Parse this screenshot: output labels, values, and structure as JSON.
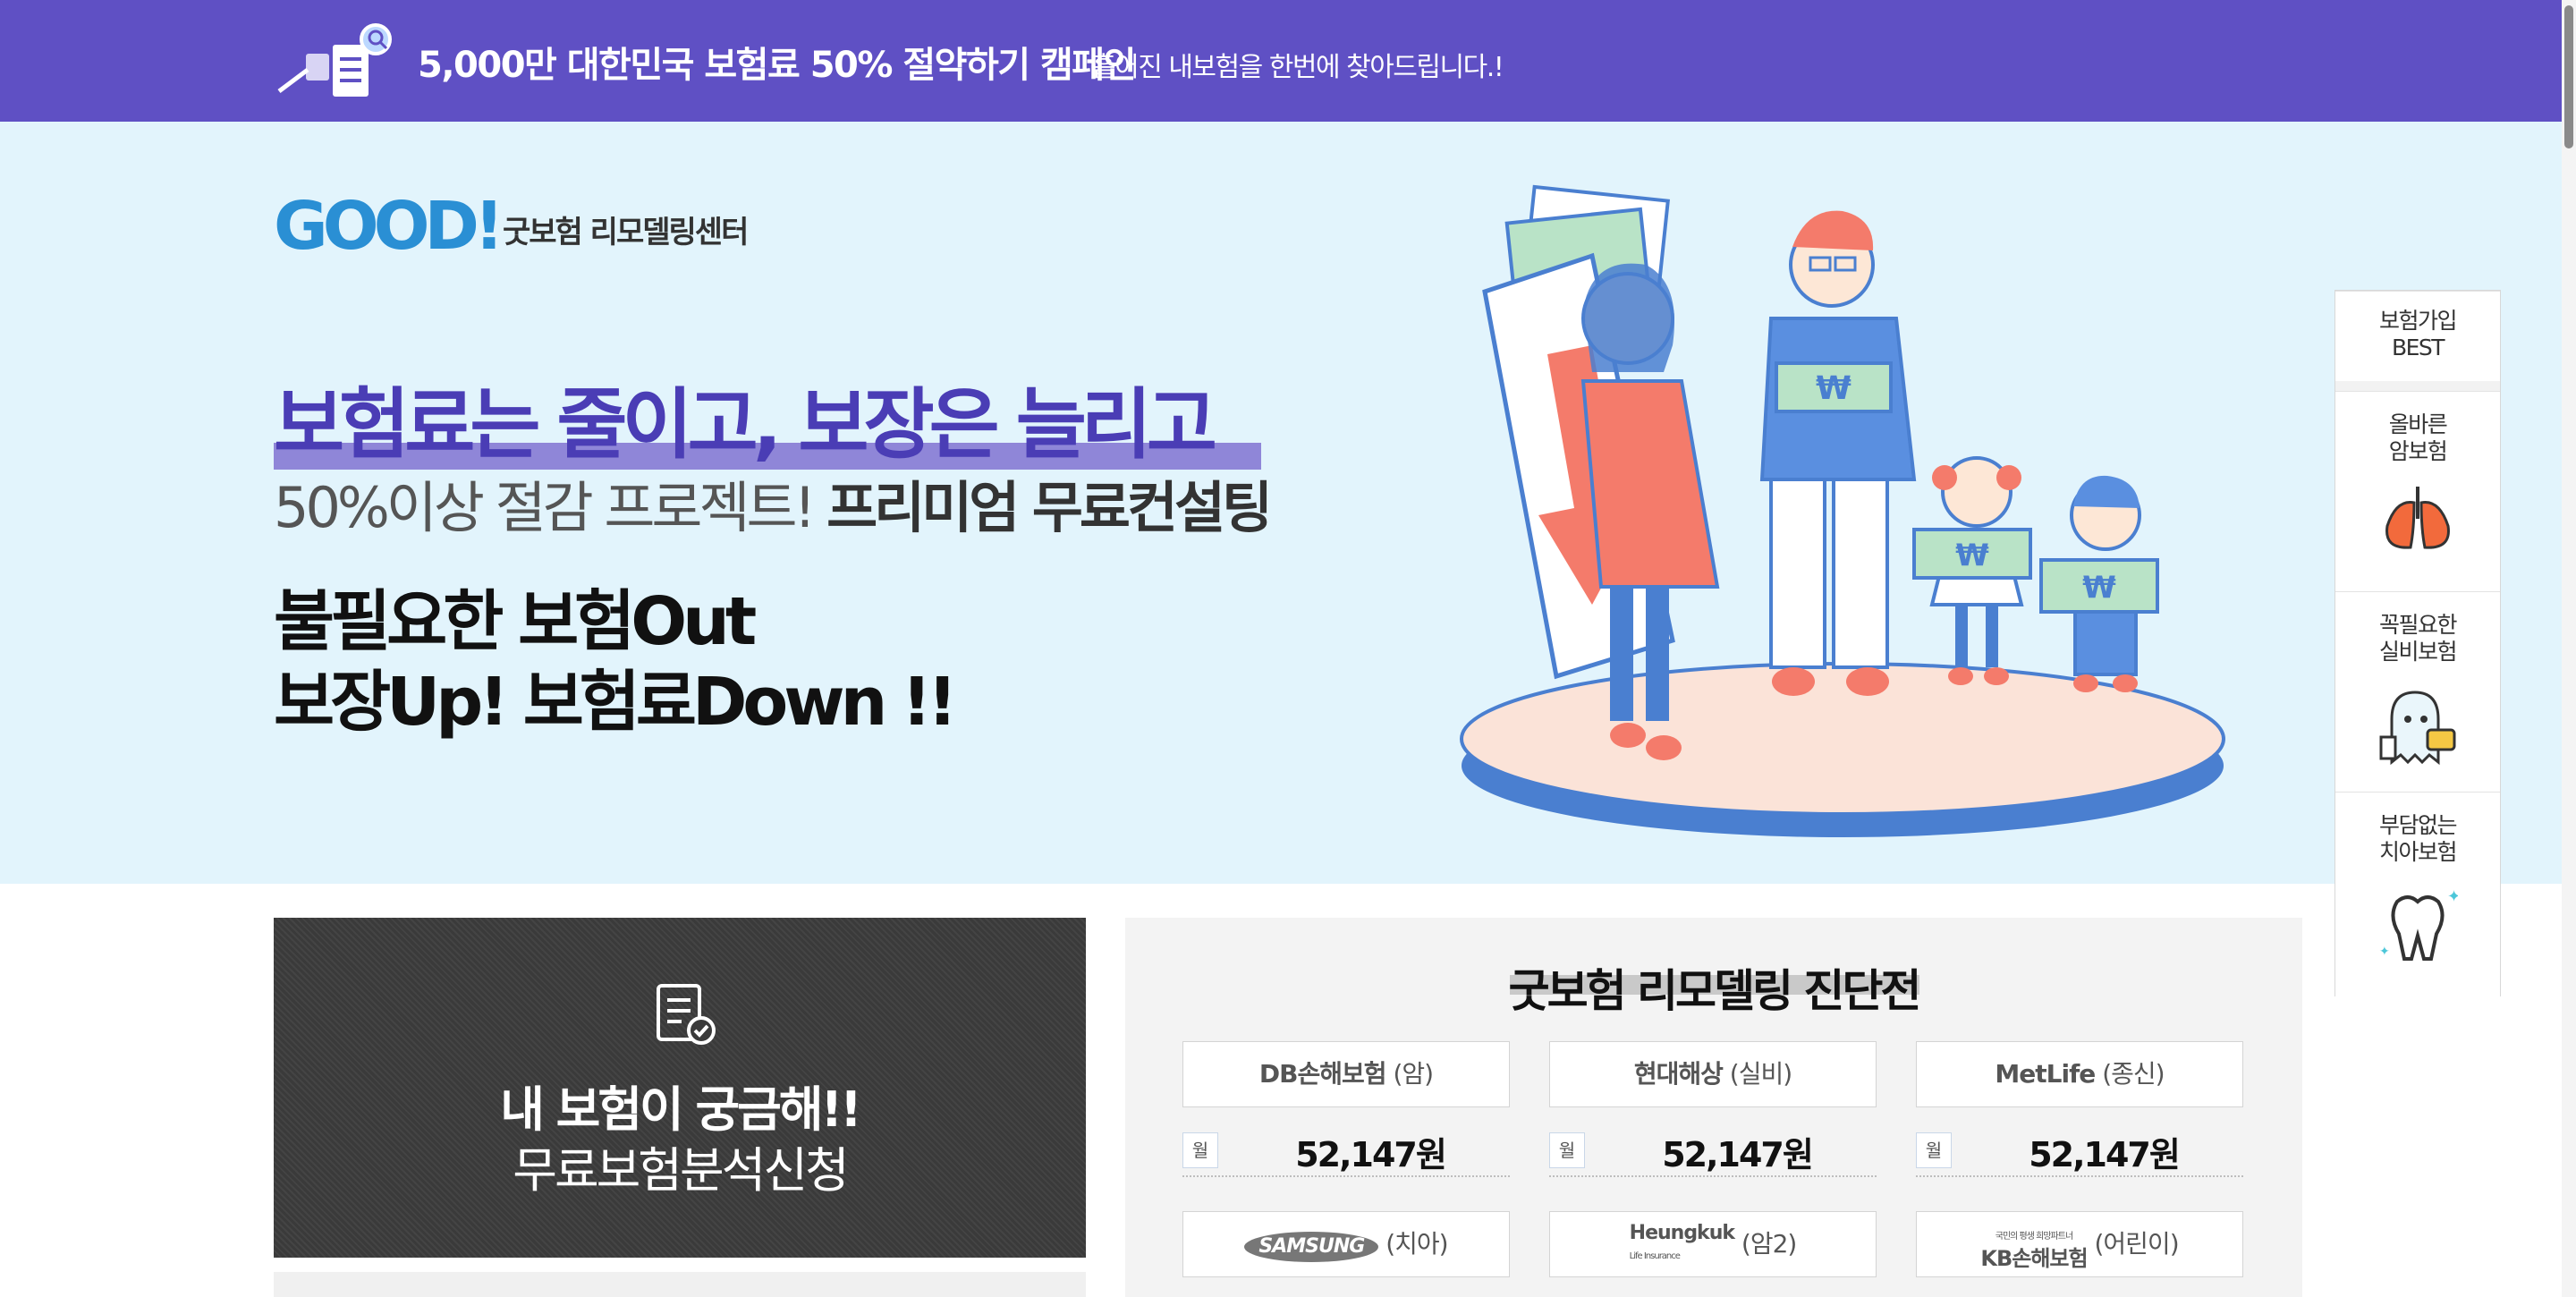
{
  "topbar": {
    "title": "5,000만 대한민국 보험료 50% 절약하기 캠페인",
    "subtitle": "흩어진 내보험을 한번에 찾아드립니다.!",
    "background": "#5f50c4"
  },
  "brand": {
    "logo_text": "GOOD!",
    "name": "굿보험 리모델링센터"
  },
  "hero": {
    "headline": "보험료는 줄이고, 보장은 늘리고",
    "subhead_light": "50%이상 절감 프로젝트! ",
    "subhead_bold": "프리미엄 무료컨설팅",
    "pitch_line1": "불필요한 보험Out",
    "pitch_line2": "보장Up! 보험료Down !!",
    "won_sign": "₩"
  },
  "quick_menu": {
    "items": [
      {
        "label": "보험가입\nBEST",
        "icon": ""
      },
      {
        "label": "올바른\n암보험",
        "icon": "lungs-icon"
      },
      {
        "label": "꼭필요한\n실비보험",
        "icon": "ghost-chat-icon"
      },
      {
        "label": "부담없는\n치아보험",
        "icon": "tooth-icon"
      }
    ]
  },
  "promo": {
    "line1": "내 보험이 궁금해!!",
    "line2": "무료보험분석신청"
  },
  "diagnosis": {
    "title": "굿보험 리모델링 진단전",
    "month_label": "월",
    "insurers": [
      {
        "logo": "DB손해보험",
        "type": "(암)",
        "price": "52,147원"
      },
      {
        "logo": "현대해상",
        "type": "(실비)",
        "price": "52,147원"
      },
      {
        "logo": "MetLife",
        "type": "(종신)",
        "price": "52,147원"
      },
      {
        "logo": "SAMSUNG",
        "type": "(치아)"
      },
      {
        "logo": "Heungkuk",
        "logo_sub": "Life Insurance",
        "type": "(암2)"
      },
      {
        "logo": "KB손해보험",
        "logo_sub": "국민의 평생 희망파트너",
        "type": "(어린이)"
      }
    ]
  }
}
